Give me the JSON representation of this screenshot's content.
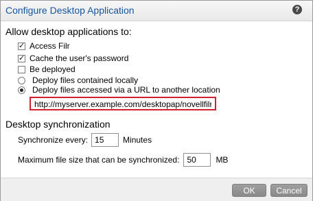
{
  "dialog": {
    "title": "Configure Desktop Application",
    "help_icon": "help-icon",
    "help_glyph": "?"
  },
  "allow": {
    "heading": "Allow desktop applications to:",
    "access_filr": {
      "label": "Access Filr",
      "checked": true
    },
    "cache_password": {
      "label": "Cache the user's password",
      "checked": true
    },
    "be_deployed": {
      "label": "Be deployed",
      "checked": false
    },
    "deploy_local": {
      "label": "Deploy files contained locally",
      "selected": false
    },
    "deploy_url": {
      "label": "Deploy files accessed via a URL to another location",
      "selected": true
    },
    "url_value": "http://myserver.example.com/desktopap/novellfilr",
    "highlight_color": "#d2202c"
  },
  "sync": {
    "heading": "Desktop synchronization",
    "every_label": "Synchronize every:",
    "every_value": "15",
    "every_unit": "Minutes",
    "max_label": "Maximum file size that can be synchronized:",
    "max_value": "50",
    "max_unit": "MB"
  },
  "footer": {
    "ok_label": "OK",
    "cancel_label": "Cancel"
  },
  "colors": {
    "title_text": "#15539e",
    "button_bg": "#8f8f8f"
  }
}
